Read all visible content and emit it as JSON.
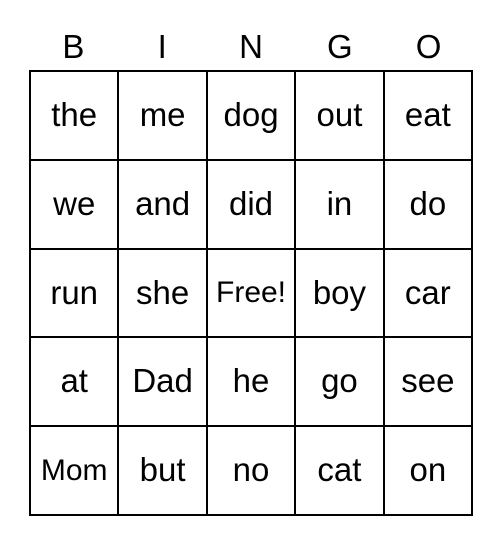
{
  "card": {
    "title": "BINGO",
    "header_letters": [
      "B",
      "I",
      "N",
      "G",
      "O"
    ],
    "free_space_label": "Free!",
    "free_space_position": {
      "row": 2,
      "column": 2
    },
    "grid_size": "5x5",
    "colors": {
      "background": "#ffffff",
      "border": "#000000",
      "text": "#000000"
    },
    "rows": [
      {
        "cells": [
          {
            "text": "the"
          },
          {
            "text": "me"
          },
          {
            "text": "dog"
          },
          {
            "text": "out"
          },
          {
            "text": "eat"
          }
        ]
      },
      {
        "cells": [
          {
            "text": "we"
          },
          {
            "text": "and"
          },
          {
            "text": "did"
          },
          {
            "text": "in"
          },
          {
            "text": "do"
          }
        ]
      },
      {
        "cells": [
          {
            "text": "run"
          },
          {
            "text": "she"
          },
          {
            "text": "Free!"
          },
          {
            "text": "boy"
          },
          {
            "text": "car"
          }
        ]
      },
      {
        "cells": [
          {
            "text": "at"
          },
          {
            "text": "Dad"
          },
          {
            "text": "he"
          },
          {
            "text": "go"
          },
          {
            "text": "see"
          }
        ]
      },
      {
        "cells": [
          {
            "text": "Mom"
          },
          {
            "text": "but"
          },
          {
            "text": "no"
          },
          {
            "text": "cat"
          },
          {
            "text": "on"
          }
        ]
      }
    ]
  }
}
